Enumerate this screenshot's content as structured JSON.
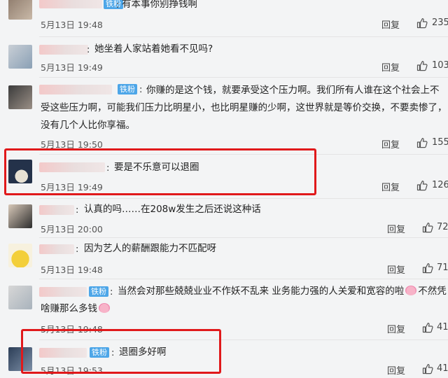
{
  "reply_label": "回复",
  "badge_label": "铁粉",
  "comments": [
    {
      "text": "有本事你别挣钱啊",
      "date": "5月13日 19:48",
      "likes": "235"
    },
    {
      "text": "她坐着人家站着她看不见吗?",
      "date": "5月13日 19:49",
      "likes": "103"
    },
    {
      "text_line1": "你赚的是这个钱，就要承受这个压力啊。我们所有人谁在这个社会上不",
      "text_line2": "受这些压力啊，可能我们压力比明星小，也比明星赚的少啊，这世界就是等价交换，不要卖惨了，",
      "text_line3": "没有几个人比你享福。",
      "date": "5月13日 19:50",
      "likes": "155"
    },
    {
      "text": "要是不乐意可以退圈",
      "date": "5月13日 19:49",
      "likes": "126"
    },
    {
      "text": "认真的吗……在208w发生之后还说这种话",
      "date": "5月13日 20:00",
      "likes": "72"
    },
    {
      "text": "因为艺人的薪酬跟能力不匹配呀",
      "date": "5月13日 19:48",
      "likes": "71"
    },
    {
      "text_line1": "当然会对那些兢兢业业不作妖不乱来 业务能力强的人关爱和宽容的啦",
      "text_line1b": "不然凭",
      "text_line2": "啥赚那么多钱",
      "date": "5月13日 19:48",
      "likes": "41"
    },
    {
      "text": "退圈多好啊",
      "date": "5月13日 19:53",
      "likes": "41"
    }
  ],
  "colors": {
    "highlight": "#e0191b",
    "badge": "#4da6e8"
  }
}
